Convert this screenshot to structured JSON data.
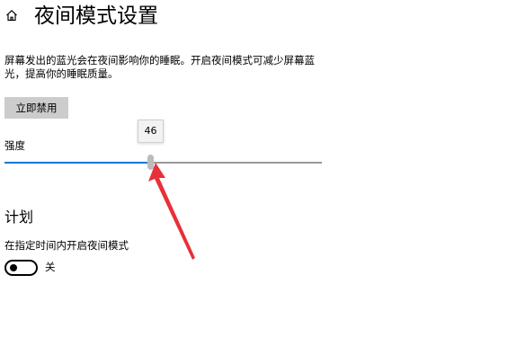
{
  "header": {
    "home_icon": "home-icon",
    "title": "夜间模式设置"
  },
  "description": "屏幕发出的蓝光会在夜间影响你的睡眠。开启夜间模式可减少屏幕蓝光，提高你的睡眠质量。",
  "disable_button_label": "立即禁用",
  "strength": {
    "label": "强度",
    "value": 46,
    "tooltip": "46",
    "accent_color": "#0078d7"
  },
  "schedule": {
    "heading": "计划",
    "option_label": "在指定时间内开启夜间模式",
    "toggle_state_label": "关",
    "toggle_on": false
  },
  "annotation": {
    "arrow_color": "#e8303a"
  }
}
